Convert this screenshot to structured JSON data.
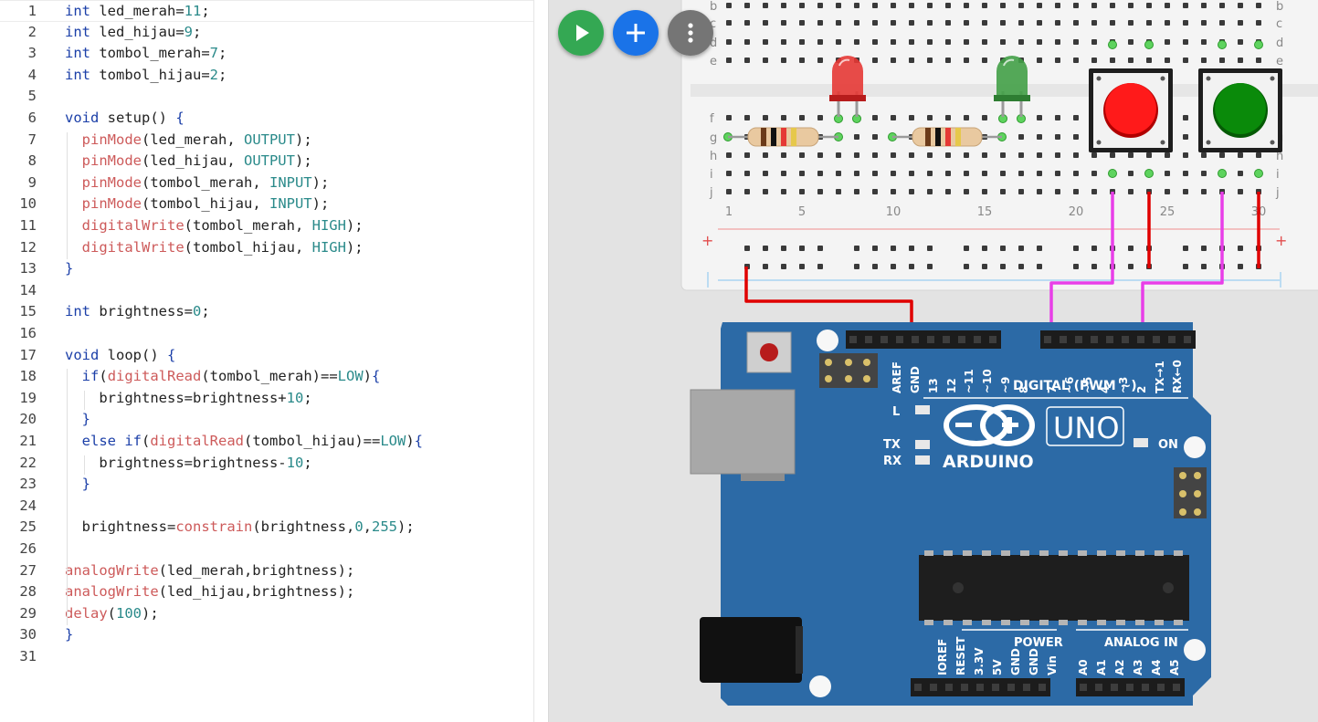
{
  "editor": {
    "lines": [
      {
        "n": "1",
        "segs": [
          [
            "kw",
            "int"
          ],
          [
            "t",
            " led_merah="
          ],
          [
            "nm",
            "11"
          ],
          [
            "t",
            ";"
          ]
        ]
      },
      {
        "n": "2",
        "segs": [
          [
            "kw",
            "int"
          ],
          [
            "t",
            " led_hijau="
          ],
          [
            "nm",
            "9"
          ],
          [
            "t",
            ";"
          ]
        ]
      },
      {
        "n": "3",
        "segs": [
          [
            "kw",
            "int"
          ],
          [
            "t",
            " tombol_merah="
          ],
          [
            "nm",
            "7"
          ],
          [
            "t",
            ";"
          ]
        ]
      },
      {
        "n": "4",
        "segs": [
          [
            "kw",
            "int"
          ],
          [
            "t",
            " tombol_hijau="
          ],
          [
            "nm",
            "2"
          ],
          [
            "t",
            ";"
          ]
        ]
      },
      {
        "n": "5",
        "segs": []
      },
      {
        "n": "6",
        "segs": [
          [
            "kw",
            "void"
          ],
          [
            "t",
            " setup() "
          ],
          [
            "kw",
            "{"
          ]
        ]
      },
      {
        "n": "7",
        "segs": [
          [
            "t",
            "  "
          ],
          [
            "fn",
            "pinMode"
          ],
          [
            "t",
            "(led_merah, "
          ],
          [
            "cn",
            "OUTPUT"
          ],
          [
            "t",
            ");"
          ]
        ]
      },
      {
        "n": "8",
        "segs": [
          [
            "t",
            "  "
          ],
          [
            "fn",
            "pinMode"
          ],
          [
            "t",
            "(led_hijau, "
          ],
          [
            "cn",
            "OUTPUT"
          ],
          [
            "t",
            ");"
          ]
        ]
      },
      {
        "n": "9",
        "segs": [
          [
            "t",
            "  "
          ],
          [
            "fn",
            "pinMode"
          ],
          [
            "t",
            "(tombol_merah, "
          ],
          [
            "cn",
            "INPUT"
          ],
          [
            "t",
            ");"
          ]
        ]
      },
      {
        "n": "10",
        "segs": [
          [
            "t",
            "  "
          ],
          [
            "fn",
            "pinMode"
          ],
          [
            "t",
            "(tombol_hijau, "
          ],
          [
            "cn",
            "INPUT"
          ],
          [
            "t",
            ");"
          ]
        ]
      },
      {
        "n": "11",
        "segs": [
          [
            "t",
            "  "
          ],
          [
            "fn",
            "digitalWrite"
          ],
          [
            "t",
            "(tombol_merah, "
          ],
          [
            "cn",
            "HIGH"
          ],
          [
            "t",
            ");"
          ]
        ]
      },
      {
        "n": "12",
        "segs": [
          [
            "t",
            "  "
          ],
          [
            "fn",
            "digitalWrite"
          ],
          [
            "t",
            "(tombol_hijau, "
          ],
          [
            "cn",
            "HIGH"
          ],
          [
            "t",
            ");"
          ]
        ]
      },
      {
        "n": "13",
        "segs": [
          [
            "kw",
            "}"
          ]
        ]
      },
      {
        "n": "14",
        "segs": []
      },
      {
        "n": "15",
        "segs": [
          [
            "kw",
            "int"
          ],
          [
            "t",
            " brightness="
          ],
          [
            "nm",
            "0"
          ],
          [
            "t",
            ";"
          ]
        ]
      },
      {
        "n": "16",
        "segs": []
      },
      {
        "n": "17",
        "segs": [
          [
            "kw",
            "void"
          ],
          [
            "t",
            " loop() "
          ],
          [
            "kw",
            "{"
          ]
        ]
      },
      {
        "n": "18",
        "segs": [
          [
            "t",
            "  "
          ],
          [
            "kw",
            "if"
          ],
          [
            "t",
            "("
          ],
          [
            "fn",
            "digitalRead"
          ],
          [
            "t",
            "(tombol_merah)=="
          ],
          [
            "cn",
            "LOW"
          ],
          [
            "t",
            ")"
          ],
          [
            "kw",
            "{"
          ]
        ]
      },
      {
        "n": "19",
        "segs": [
          [
            "t",
            "    brightness=brightness+"
          ],
          [
            "nm",
            "10"
          ],
          [
            "t",
            ";"
          ]
        ]
      },
      {
        "n": "20",
        "segs": [
          [
            "t",
            "  "
          ],
          [
            "kw",
            "}"
          ]
        ]
      },
      {
        "n": "21",
        "segs": [
          [
            "t",
            "  "
          ],
          [
            "kw",
            "else if"
          ],
          [
            "t",
            "("
          ],
          [
            "fn",
            "digitalRead"
          ],
          [
            "t",
            "(tombol_hijau)=="
          ],
          [
            "cn",
            "LOW"
          ],
          [
            "t",
            ")"
          ],
          [
            "kw",
            "{"
          ]
        ]
      },
      {
        "n": "22",
        "segs": [
          [
            "t",
            "    brightness=brightness-"
          ],
          [
            "nm",
            "10"
          ],
          [
            "t",
            ";"
          ]
        ]
      },
      {
        "n": "23",
        "segs": [
          [
            "t",
            "  "
          ],
          [
            "kw",
            "}"
          ]
        ]
      },
      {
        "n": "24",
        "segs": []
      },
      {
        "n": "25",
        "segs": [
          [
            "t",
            "  brightness="
          ],
          [
            "fn",
            "constrain"
          ],
          [
            "t",
            "(brightness,"
          ],
          [
            "nm",
            "0"
          ],
          [
            "t",
            ","
          ],
          [
            "nm",
            "255"
          ],
          [
            "t",
            ");"
          ]
        ]
      },
      {
        "n": "26",
        "segs": []
      },
      {
        "n": "27",
        "segs": [
          [
            "fn",
            "analogWrite"
          ],
          [
            "t",
            "(led_merah,brightness);"
          ]
        ]
      },
      {
        "n": "28",
        "segs": [
          [
            "fn",
            "analogWrite"
          ],
          [
            "t",
            "(led_hijau,brightness);"
          ]
        ]
      },
      {
        "n": "29",
        "segs": [
          [
            "fn",
            "delay"
          ],
          [
            "t",
            "("
          ],
          [
            "nm",
            "100"
          ],
          [
            "t",
            ");"
          ]
        ]
      },
      {
        "n": "30",
        "segs": [
          [
            "kw",
            "}"
          ]
        ]
      },
      {
        "n": "31",
        "segs": []
      }
    ],
    "colors": {
      "keyword": "#1b3fa8",
      "function": "#cd5a5a",
      "constant": "#2a8a8a",
      "text": "#222222"
    }
  },
  "toolbar": {
    "run_icon": "play-icon",
    "run_color": "#34a853",
    "add_icon": "plus-icon",
    "add_color": "#1a73e8",
    "more_icon": "more-vert-icon",
    "more_color": "#757575"
  },
  "breadboard": {
    "row_labels_top": [
      "b",
      "c",
      "d",
      "e"
    ],
    "row_labels_bottom": [
      "f",
      "g",
      "h",
      "i",
      "j"
    ],
    "column_numbers": [
      "1",
      "5",
      "10",
      "15",
      "20",
      "25",
      "30"
    ],
    "plus_label": "+"
  },
  "arduino": {
    "board_name": "UNO",
    "brand": "ARDUINO",
    "digital_label": "DIGITAL (PWM ~)",
    "digital_pins": [
      "AREF",
      "GND",
      "13",
      "12",
      "~11",
      "~10",
      "~9",
      "8",
      "7",
      "~6",
      "~5",
      "4",
      "~3",
      "2",
      "TX→1",
      "RX←0"
    ],
    "led_labels": {
      "l": "L",
      "tx": "TX",
      "rx": "RX",
      "on": "ON"
    },
    "power_label": "POWER",
    "power_pins": [
      "IOREF",
      "RESET",
      "3.3V",
      "5V",
      "GND",
      "GND",
      "Vin"
    ],
    "analog_label": "ANALOG IN",
    "analog_pins": [
      "A0",
      "A1",
      "A2",
      "A3",
      "A4",
      "A5"
    ],
    "board_color": "#2c6aa6"
  },
  "components": {
    "led_red_color": "#e53935",
    "led_green_color": "#43a047",
    "button_red_color": "#ff1a1a",
    "button_green_color": "#0a8a0a",
    "wire_red_color": "#e00000",
    "wire_magenta_color": "#e83ee8"
  }
}
